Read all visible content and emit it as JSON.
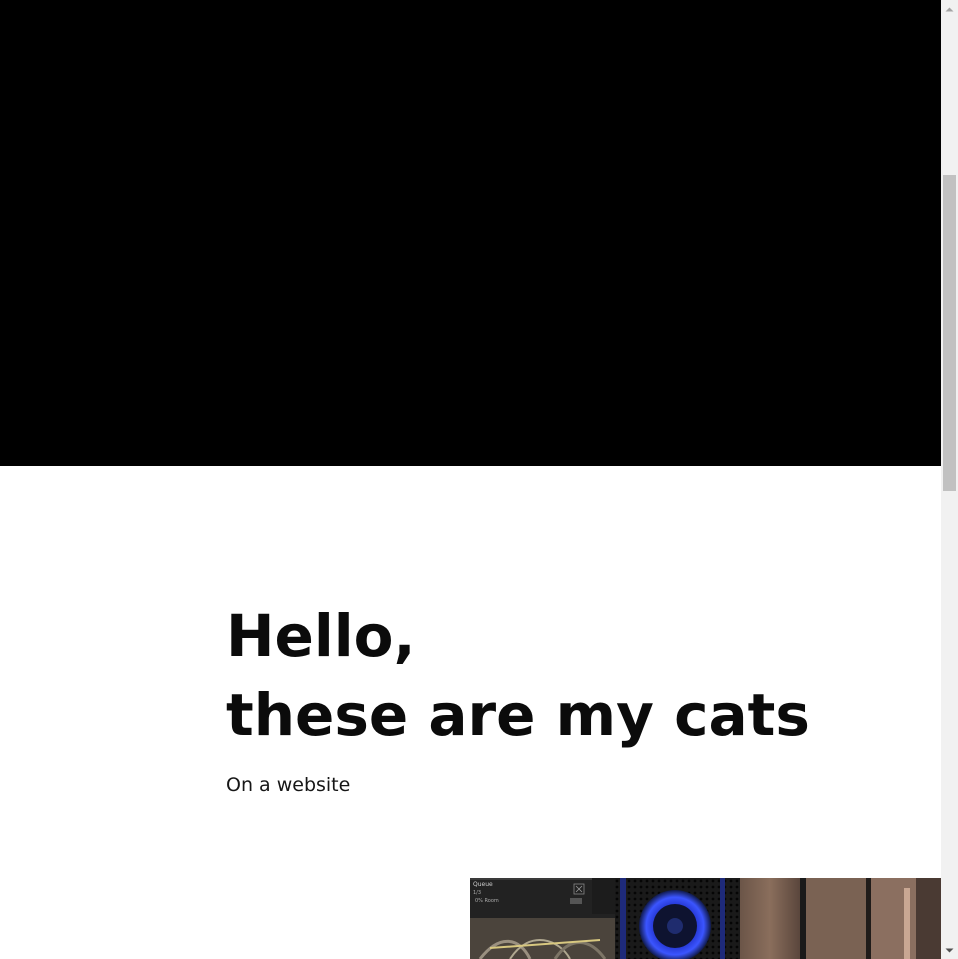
{
  "hero": {
    "media": "video-player",
    "background": "#000000"
  },
  "intro": {
    "title_line1": "Hello,",
    "title_line2": "these are my cats",
    "subtitle": "On a website"
  },
  "photo": {
    "kind": "cat-photo",
    "overlay_panel_title": "Queue",
    "overlay_panel_line": "1/3",
    "overlay_panel_line2": "0% Room"
  },
  "scrollbar": {
    "position_fraction": 0.18
  }
}
